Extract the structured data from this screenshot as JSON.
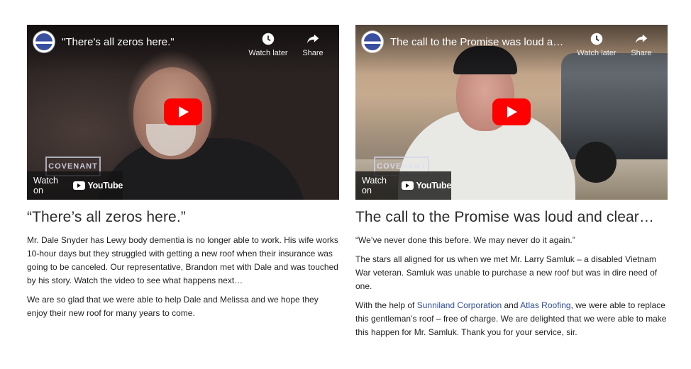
{
  "videos": [
    {
      "overlay_title": "\"There's all zeros here.\"",
      "watch_later_label": "Watch later",
      "share_label": "Share",
      "watch_on_label": "Watch on",
      "youtube_label": "YouTube",
      "watermark": "COVENANT"
    },
    {
      "overlay_title": "The call to the Promise was loud and cl...",
      "watch_later_label": "Watch later",
      "share_label": "Share",
      "watch_on_label": "Watch on",
      "youtube_label": "YouTube",
      "watermark": "COVENANT"
    }
  ],
  "left": {
    "heading": "“There’s all zeros here.”",
    "p1": "Mr. Dale Snyder has Lewy body dementia is no longer able to work. His wife works 10-hour days but they struggled with getting a new roof when their insurance was going to be canceled. Our representative, Brandon met with Dale and was touched by his story. Watch the video to see what happens next…",
    "p2": "We are so glad that we were able to help Dale and Melissa and we hope they enjoy their new roof for many years to come."
  },
  "right": {
    "heading": "The call to the Promise was loud and clear…",
    "p1": "“We’ve never done this before. We may never do it again.”",
    "p2": "The stars all aligned for us when we met Mr. Larry Samluk – a disabled Vietnam War veteran. Samluk was unable to purchase a new roof but was in dire need of one.",
    "p3_before": "With the help of ",
    "p3_link1": "Sunniland Corporation",
    "p3_mid": " and ",
    "p3_link2": "Atlas Roofing",
    "p3_after": ", we were able to replace this gentleman’s roof – free of charge. We are delighted that we were able to make this happen for Mr. Samluk. Thank you for your service, sir."
  }
}
